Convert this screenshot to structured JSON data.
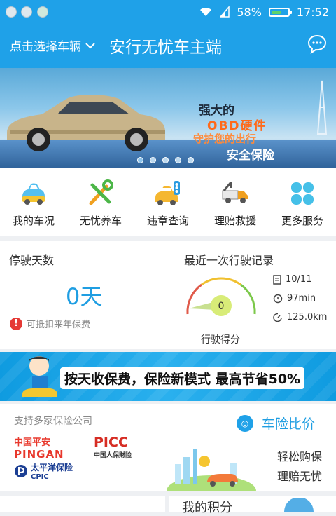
{
  "status_bar": {
    "battery_percent": "58%",
    "battery_level": 0.58,
    "time": "17:52"
  },
  "header": {
    "select_vehicle": "点击选择车辆",
    "title": "安行无忧车主端"
  },
  "banner": {
    "line1": "强大的",
    "line2": "OBD硬件",
    "line3": "守护您的出行",
    "line4": "安全保险",
    "active_slide": 1,
    "slide_count": 5
  },
  "menu": [
    {
      "label": "我的车况",
      "icon": "car-icon"
    },
    {
      "label": "无忧养车",
      "icon": "wrench-screwdriver-icon"
    },
    {
      "label": "违章查询",
      "icon": "traffic-light-car-icon"
    },
    {
      "label": "理赔救援",
      "icon": "tow-truck-icon"
    },
    {
      "label": "更多服务",
      "icon": "four-petal-icon"
    }
  ],
  "parking": {
    "title": "停驶天数",
    "value": "0天",
    "note": "可抵扣来年保费"
  },
  "last_drive": {
    "title": "最近一次行驶记录",
    "score": "0",
    "score_label": "行驶得分",
    "date": "10/11",
    "duration": "97min",
    "distance": "125.0km"
  },
  "promo": {
    "text": "按天收保费，保险新模式 最高节省50%"
  },
  "insurance": {
    "title": "支持多家保险公司",
    "company1_cn": "中国平安",
    "company1_en": "PINGAN",
    "company2_cn": "PICC",
    "company2_sub": "中国人保财险",
    "company3_cn": "太平洋保险",
    "company3_en": "CPIC",
    "compare_title": "车险比价",
    "line1": "轻松购保",
    "line2": "理赔无忧"
  },
  "bottom": {
    "points_title": "我的积分"
  },
  "colors": {
    "primary": "#1fa1e8",
    "warning": "#e53935"
  }
}
